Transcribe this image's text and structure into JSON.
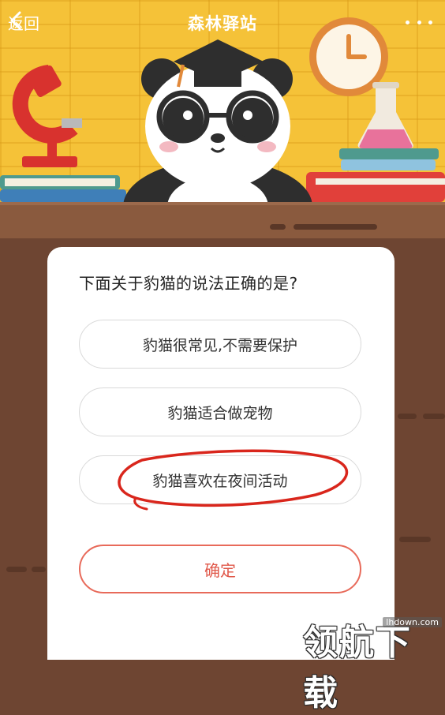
{
  "nav": {
    "back_label": "返回",
    "title": "森林驿站"
  },
  "quiz": {
    "question": "下面关于豹猫的说法正确的是?",
    "options": [
      {
        "text": "豹猫很常见,不需要保护"
      },
      {
        "text": "豹猫适合做宠物"
      },
      {
        "text": "豹猫喜欢在夜间活动",
        "circled": true
      }
    ],
    "confirm_label": "确定"
  },
  "watermark": {
    "text": "领航下载",
    "url": "lhdown.com"
  },
  "colors": {
    "scene_background": "#f5c238",
    "wood": "#6e4532",
    "accent_red": "#e0584a",
    "circle_mark": "#d9261c"
  }
}
